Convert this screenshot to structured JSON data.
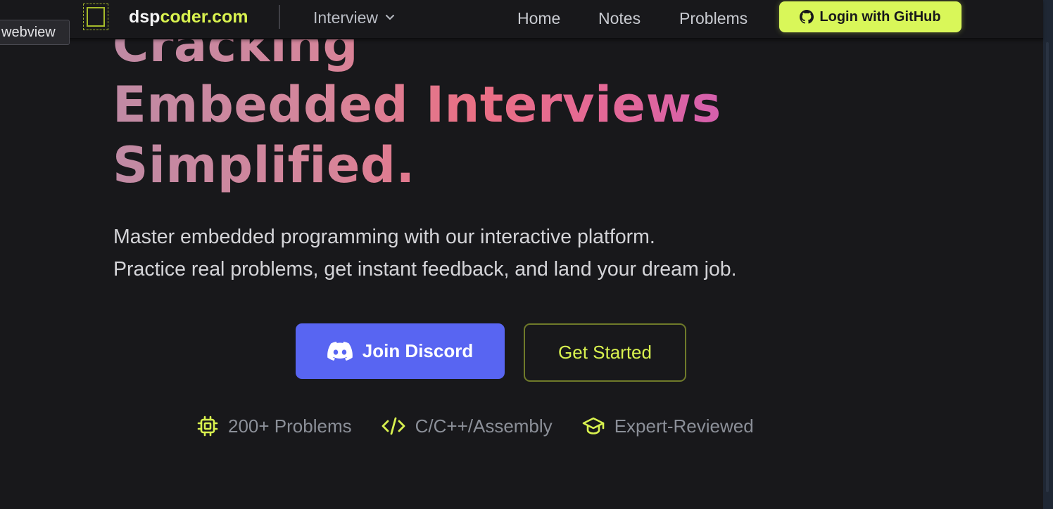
{
  "navbar": {
    "brand_prefix": "dsp",
    "brand_suffix": "coder.com",
    "dropdown_label": "Interview",
    "links": [
      "Home",
      "Notes",
      "Problems"
    ],
    "login_label": "Login with GitHub"
  },
  "tooltip": {
    "label": "webview"
  },
  "hero": {
    "heading_lines": [
      "Cracking",
      "Embedded Interviews",
      "Simplified."
    ],
    "subtitle_lines": [
      "Master embedded programming with our interactive platform.",
      "Practice real problems, get instant feedback, and land your dream job."
    ],
    "discord_button": "Join Discord",
    "get_started_button": "Get Started"
  },
  "features": [
    {
      "icon": "chip-icon",
      "label": "200+ Problems"
    },
    {
      "icon": "code-icon",
      "label": "C/C++/Assembly"
    },
    {
      "icon": "graduation-cap-icon",
      "label": "Expert-Reviewed"
    }
  ],
  "colors": {
    "background": "#18181b",
    "accent": "#d9f24f",
    "discord": "#5865f2",
    "heading_gradient_start": "#c08aa4",
    "heading_gradient_end": "#d45fae"
  }
}
